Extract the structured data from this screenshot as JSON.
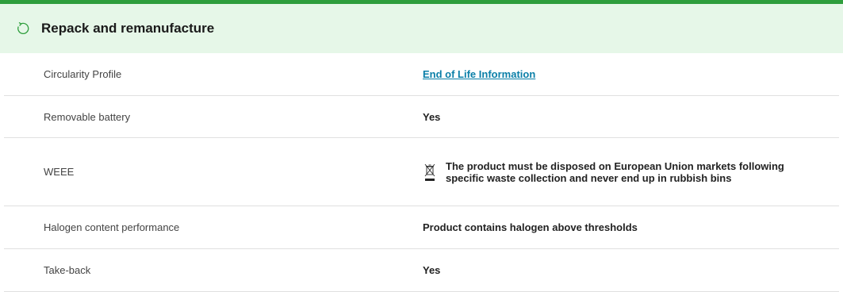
{
  "section": {
    "title": "Repack and remanufacture",
    "icon": "refresh-icon",
    "accent_color": "#2e9e3c",
    "header_bg": "#e6f7e8"
  },
  "rows": [
    {
      "label": "Circularity Profile",
      "value": "End of Life Information"
    },
    {
      "label": "Removable battery",
      "value": "Yes"
    },
    {
      "label": "WEEE",
      "value": "The product must be disposed on European Union markets following specific waste collection and never end up in rubbish bins",
      "icon": "crossed-bin-icon"
    },
    {
      "label": "Halogen content performance",
      "value": "Product contains halogen above thresholds"
    },
    {
      "label": "Take-back",
      "value": "Yes"
    }
  ],
  "link_color": "#0a7fa8"
}
